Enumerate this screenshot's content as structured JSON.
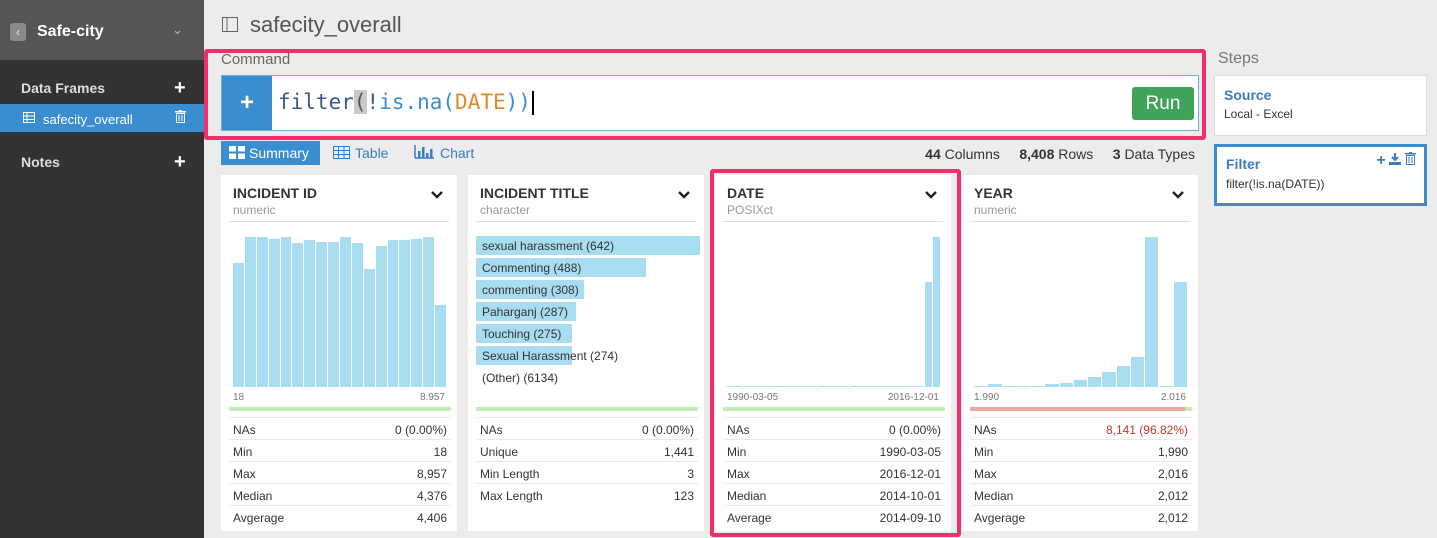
{
  "sidebar": {
    "project": "Safe-city",
    "data_frames_label": "Data Frames",
    "notes_label": "Notes",
    "items": [
      {
        "label": "safecity_overall"
      }
    ]
  },
  "dataset_title": "safecity_overall",
  "command": {
    "label": "Command",
    "fn": "filter",
    "open": "(",
    "bang": "!",
    "call": "is.na",
    "p_open": "(",
    "arg": "DATE",
    "p_close": ")",
    "close": ")",
    "run_label": "Run"
  },
  "tabs": {
    "summary": "Summary",
    "table": "Table",
    "chart": "Chart"
  },
  "stats": {
    "columns": "44",
    "columns_label": "Columns",
    "rows": "8,408",
    "rows_label": "Rows",
    "types": "3",
    "types_label": "Data Types"
  },
  "columns": [
    {
      "name": "INCIDENT ID",
      "type": "numeric",
      "axis_min": "18",
      "axis_max": "8.957",
      "hist": [
        0.83,
        1.0,
        1.0,
        0.99,
        1.0,
        0.96,
        0.98,
        0.97,
        0.97,
        1.0,
        0.96,
        0.79,
        0.94,
        0.98,
        0.98,
        0.99,
        1.0,
        0.55
      ],
      "na_ratio": 0.0,
      "stats": [
        {
          "k": "NAs",
          "v": "0 (0.00%)"
        },
        {
          "k": "Min",
          "v": "18"
        },
        {
          "k": "Max",
          "v": "8,957"
        },
        {
          "k": "Median",
          "v": "4,376"
        },
        {
          "k": "Avgerage",
          "v": "4,406"
        }
      ]
    },
    {
      "name": "INCIDENT TITLE",
      "type": "character",
      "top": [
        {
          "label": "sexual harassment (642)",
          "value": 642
        },
        {
          "label": "Commenting (488)",
          "value": 488
        },
        {
          "label": "commenting (308)",
          "value": 308
        },
        {
          "label": "Paharganj (287)",
          "value": 287
        },
        {
          "label": "Touching (275)",
          "value": 275
        },
        {
          "label": "Sexual Harassment (274)",
          "value": 274
        },
        {
          "label": "(Other) (6134)",
          "value": 0
        }
      ],
      "na_ratio": 0.0,
      "stats": [
        {
          "k": "NAs",
          "v": "0 (0.00%)"
        },
        {
          "k": "Unique",
          "v": "1,441"
        },
        {
          "k": "Min Length",
          "v": "3"
        },
        {
          "k": "Max Length",
          "v": "123"
        }
      ]
    },
    {
      "name": "DATE",
      "type": "POSIXct",
      "axis_min": "1990-03-05",
      "axis_max": "2016-12-01",
      "hist": [
        0.01,
        0.01,
        0.01,
        0.01,
        0.01,
        0.01,
        0.01,
        0.01,
        0.01,
        0.01,
        0.01,
        0.01,
        0.01,
        0.01,
        0.01,
        0.01,
        0.01,
        0.01,
        0.01,
        0.01,
        0.01,
        0.01,
        0.01,
        0.01,
        0.7,
        1.0
      ],
      "na_ratio": 0.0,
      "stats": [
        {
          "k": "NAs",
          "v": "0 (0.00%)"
        },
        {
          "k": "Min",
          "v": "1990-03-05"
        },
        {
          "k": "Max",
          "v": "2016-12-01"
        },
        {
          "k": "Median",
          "v": "2014-10-01"
        },
        {
          "k": "Average",
          "v": "2014-09-10"
        }
      ]
    },
    {
      "name": "YEAR",
      "type": "numeric",
      "axis_min": "1.990",
      "axis_max": "2.016",
      "hist": [
        0.01,
        0.02,
        0.01,
        0.01,
        0.01,
        0.02,
        0.03,
        0.05,
        0.07,
        0.1,
        0.14,
        0.2,
        1.0,
        0.01,
        0.7
      ],
      "na_ratio": 0.9682,
      "na_highlight": true,
      "stats": [
        {
          "k": "NAs",
          "v": "8,141 (96.82%)"
        },
        {
          "k": "Min",
          "v": "1,990"
        },
        {
          "k": "Max",
          "v": "2,016"
        },
        {
          "k": "Median",
          "v": "2,012"
        },
        {
          "k": "Avgerage",
          "v": "2,012"
        }
      ]
    }
  ],
  "steps": {
    "title": "Steps",
    "items": [
      {
        "title": "Source",
        "desc": "Local - Excel"
      },
      {
        "title": "Filter",
        "desc": "filter(!is.na(DATE))"
      }
    ]
  },
  "colors": {
    "accent": "#3a8ed0",
    "highlight": "#f02e6a",
    "run": "#3fa45a",
    "bar": "#a8dcf0",
    "na_ok": "#c4ebb5",
    "na_bad": "#e9a89e",
    "na_text": "#c0392b"
  }
}
